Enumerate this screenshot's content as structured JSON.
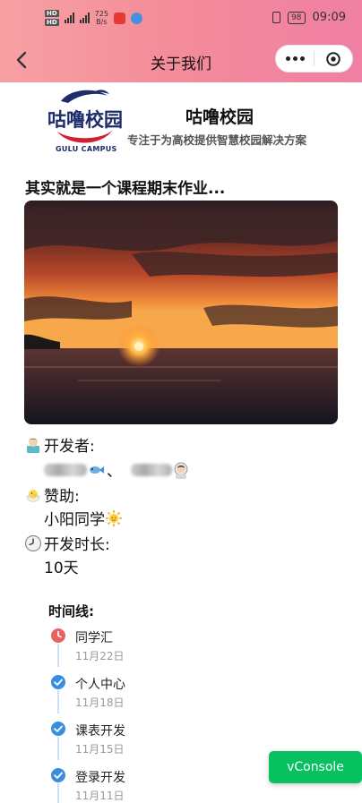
{
  "status_bar": {
    "network_speed": "725",
    "network_unit": "B/s",
    "battery": "98",
    "time": "09:09"
  },
  "navbar": {
    "title": "关于我们"
  },
  "brand": {
    "logo_text": "咕噜校园",
    "logo_caption": "GULU CAMPUS",
    "name": "咕噜校园",
    "slogan": "专注于为高校提供智慧校园解决方案"
  },
  "headline": "其实就是一个课程期末作业...",
  "info": {
    "developer_label": "开发者:",
    "separator": "、",
    "sponsor_label": "赞助:",
    "sponsor_value": "小阳同学",
    "duration_label": "开发时长:",
    "duration_value": "10天"
  },
  "timeline": {
    "title": "时间线:",
    "items": [
      {
        "label": "同学汇",
        "date": "11月22日",
        "status": "current"
      },
      {
        "label": "个人中心",
        "date": "11月18日",
        "status": "done"
      },
      {
        "label": "课表开发",
        "date": "11月15日",
        "status": "done"
      },
      {
        "label": "登录开发",
        "date": "11月11日",
        "status": "done"
      }
    ]
  },
  "vconsole": "vConsole",
  "colors": {
    "header_start": "#f7a1a4",
    "header_end": "#f07fa3",
    "timeline_done": "#3b8de0",
    "timeline_current": "#e8625f",
    "vconsole_green": "#07c160"
  },
  "icons": [
    "back-arrow-icon",
    "more-dots-icon",
    "close-target-icon",
    "developer-emoji-icon",
    "chick-emoji-icon",
    "clock-emoji-icon",
    "sun-emoji-icon",
    "fish-emoji-icon",
    "astronaut-emoji-icon",
    "check-circle-icon",
    "clock-circle-icon"
  ]
}
